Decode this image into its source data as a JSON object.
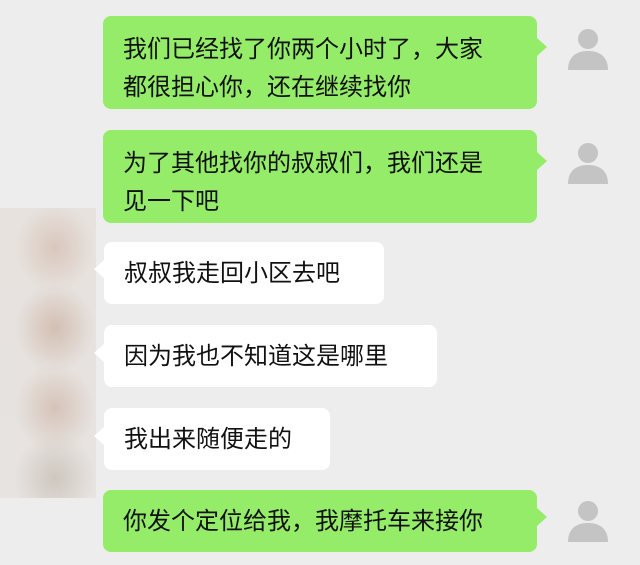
{
  "messages": [
    {
      "side": "sent",
      "text": "我们已经找了你两个小时了，大家\n都很担心你，还在继续找你",
      "avatar_icon": "default-user-icon"
    },
    {
      "side": "sent",
      "text": "为了其他找你的叔叔们，我们还是\n见一下吧",
      "avatar_icon": "default-user-icon"
    },
    {
      "side": "received",
      "text": "叔叔我走回小区去吧"
    },
    {
      "side": "received",
      "text": "因为我也不知道这是哪里"
    },
    {
      "side": "received",
      "text": "我出来随便走的"
    },
    {
      "side": "sent",
      "text": "你发个定位给我，我摩托车来接你",
      "avatar_icon": "default-user-icon"
    }
  ],
  "colors": {
    "background": "#ededed",
    "sent_bubble": "#95ec69",
    "received_bubble": "#ffffff",
    "avatar_glyph": "#c4c4c4"
  }
}
